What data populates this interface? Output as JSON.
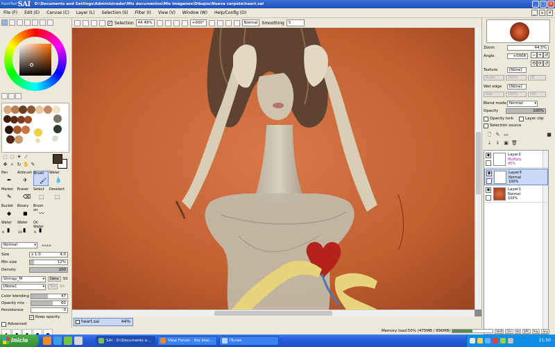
{
  "app": {
    "logo_small": "PaintTool",
    "logo_big": "SAI"
  },
  "titlebar": {
    "title": "D:\\Documents and Settings\\Administrador\\Mis documentos\\Mis imágenes\\Dibujos\\Nueva carpeta\\heart.sai"
  },
  "menu": [
    "File (F)",
    "Edit (E)",
    "Canvas (C)",
    "Layer (L)",
    "Selection (S)",
    "Filter (I)",
    "View (V)",
    "Window (W)",
    "Help/Config (O)"
  ],
  "toolbar": {
    "selection_label": "Selection",
    "selection_checked": true,
    "zoom": "44.48%",
    "angle": "+000°",
    "mode": "Normal",
    "smoothing_label": "Smoothing",
    "smoothing_value": "5"
  },
  "brushes": [
    {
      "name": "Pen",
      "size": ""
    },
    {
      "name": "Airbrush",
      "size": ""
    },
    {
      "name": "Brush",
      "size": ""
    },
    {
      "name": "Water",
      "size": ""
    },
    {
      "name": "Marker",
      "size": ""
    },
    {
      "name": "Eraser",
      "size": ""
    },
    {
      "name": "Select",
      "size": ""
    },
    {
      "name": "Deselect",
      "size": ""
    },
    {
      "name": "Bucket",
      "size": ""
    },
    {
      "name": "Binary",
      "size": ""
    },
    {
      "name": "Brush str",
      "size": ""
    },
    {
      "name": "",
      "size": ""
    },
    {
      "name": "Water",
      "size": "9"
    },
    {
      "name": "Water",
      "size": "10"
    },
    {
      "name": "Oil Water",
      "size": "9"
    },
    {
      "name": "",
      "size": ""
    }
  ],
  "tool_props": {
    "blend": "Normal",
    "size_label": "Size",
    "size_mult": "x 1.0",
    "size_value": "4.0",
    "min_size_label": "Min size",
    "min_size_value": "12%",
    "min_size_pct": 12,
    "density_label": "Density",
    "density_value": "100",
    "density_pct": 100,
    "texture": "Stringy_M",
    "dens_label": "Dens",
    "dens_value": "50",
    "texture2": "[None]",
    "tex_label": "Tex",
    "tex_value": "95",
    "color_blending_label": "Color blending",
    "color_blending_value": "47",
    "color_blending_pct": 47,
    "opacity_mix_label": "Opacity mix",
    "opacity_mix_value": "60",
    "opacity_mix_pct": 60,
    "persistence_label": "Persistence",
    "persistence_value": "0",
    "persistence_pct": 0,
    "keep_opacity_label": "Keep opacity",
    "advanced_label": "Advanced",
    "dot_sizes": [
      "0.7",
      "0.8",
      "1",
      "1.5",
      "2"
    ]
  },
  "document": {
    "tab_name": "heart.sai",
    "tab_zoom": "44%"
  },
  "navigator": {
    "zoom_label": "Zoom",
    "zoom_value": "44.5%",
    "angle_label": "Angle",
    "angle_value": "+0008"
  },
  "layer_props": {
    "texture_label": "Texture",
    "texture_value": "[None]",
    "scale_label": "Scale",
    "scale_value": "100%",
    "scale_num": "20",
    "wet_edge_label": "Wet edge",
    "wet_edge_value": "[None]",
    "size_label": "Size",
    "size_value": "100%",
    "size_num": "100",
    "blend_mode_label": "Blend mode",
    "blend_mode_value": "Normal",
    "opacity_label": "Opacity",
    "opacity_value": "100%",
    "opacity_pct": 100,
    "opacity_lock_label": "Opacity lock",
    "layer_clip_label": "Layer clip",
    "selection_source_label": "Selection source"
  },
  "layers": [
    {
      "name": "Layer2",
      "mode": "Multiply",
      "opacity": "45%",
      "selected": false
    },
    {
      "name": "Layer3",
      "mode": "Normal",
      "opacity": "100%",
      "selected": true
    },
    {
      "name": "Layer1",
      "mode": "Normal",
      "opacity": "100%",
      "selected": false
    }
  ],
  "status": {
    "memory_label": "Memory load:50% (475MB / 896MB)",
    "memory_pct": 50,
    "keys": [
      "Shift",
      "Ctrl",
      "Alt",
      "SPC",
      "Any",
      "Any"
    ]
  },
  "taskbar": {
    "start_label": "Inicio",
    "tasks": [
      {
        "label": "SAI - D:\\Documents a...",
        "active": true
      },
      {
        "label": "View Forum - the blac...",
        "active": false
      },
      {
        "label": "iTunes",
        "active": false
      }
    ],
    "clock": "21:50"
  },
  "colors": {
    "accent": "#245edb",
    "canvas_bg": "#c4622f",
    "selected_row": "#c8d8f6",
    "foreground": "#4b3521",
    "background": "#ffffff"
  }
}
